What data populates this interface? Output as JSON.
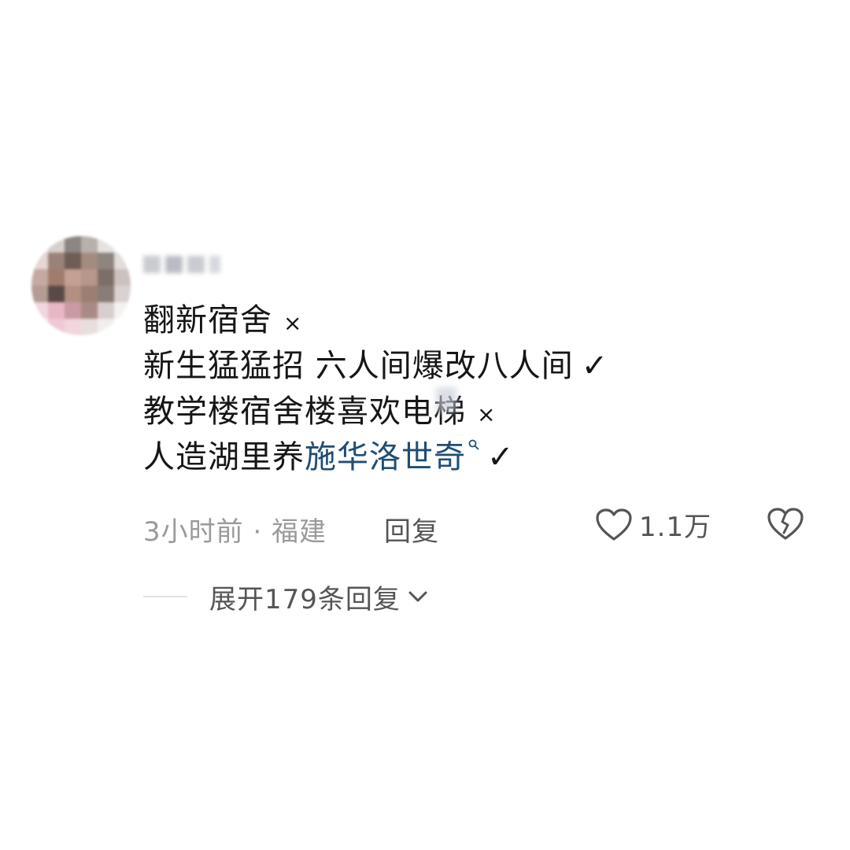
{
  "comment": {
    "lines": [
      {
        "text": "翻新宿舍",
        "mark": "×"
      },
      {
        "text": "新生猛猛招 六人间爆改八人间",
        "mark": "✓"
      },
      {
        "text": "教学楼宿舍楼喜欢电梯",
        "mark": "×"
      },
      {
        "text": "人造湖里养",
        "link": "施华洛世奇",
        "mark": "✓"
      }
    ],
    "meta": {
      "time_location": "3小时前 · 福建",
      "reply_label": "回复",
      "like_count": "1.1万"
    },
    "expand_label": "展开179条回复"
  },
  "colors": {
    "text": "#161616",
    "meta_gray": "#9a9a9a",
    "link_blue": "#1f4e73"
  },
  "icons": [
    "search-icon",
    "heart-icon",
    "broken-heart-icon",
    "chevron-down-icon"
  ]
}
